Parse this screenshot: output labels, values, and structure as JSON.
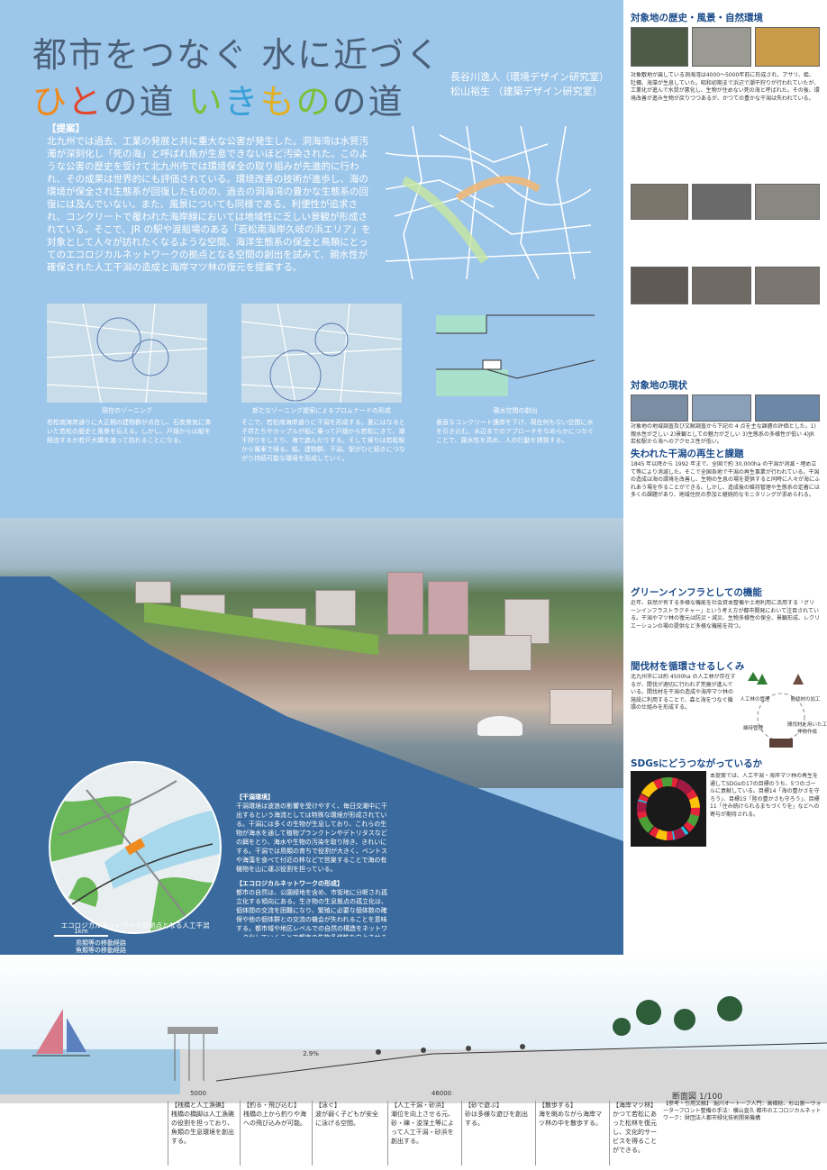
{
  "header": {
    "title": "都市をつなぐ 水に近づく",
    "subtitle_parts": [
      "ひ",
      "と",
      "の道 ",
      "い",
      "き",
      "も",
      "の",
      "の道"
    ],
    "authors": [
      "長谷川逸人（環境デザイン研究室）",
      "松山裕生 （建築デザイン研究室）"
    ]
  },
  "proposal": {
    "heading": "【提案】",
    "body": "北九州では過去、工業の発展と共に重大な公害が発生した。洞海湾は水質汚濁が深刻化し「死の海」と呼ばれ魚が生息できないほど汚染された。このような公害の歴史を受けて北九州市では環境保全の取り組みが先進的に行われ、その成果は世界的にも評価されている。環境改善の技術が進歩し、海の環境が保全され生態系が回復したものの、過去の洞海湾の豊かな生態系の回復には及んでいない。また、風景についても同様である。利便性が追求され、コンクリートで覆われた海岸線においては地域性に乏しい景観が形成されている。そこで、JR の駅や渡船場のある「若松南海岸久岐の浜エリア」を対象として人々が訪れたくなるような空間、海洋生態系の保全と鳥類にとってのエコロジカルネットワークの拠点となる空間の創出を試みて、親水性が確保された人工干潟の造成と海岸マツ林の復元を提案する。"
  },
  "diagrams": {
    "zoning": {
      "title": "現在のゾーニング",
      "text": "若松南海岸通りに大正期の建物群が点在し、石炭景気に沸いた若松の歴史と風景を伝える。しかし、戸畑からは船を経由するか若戸大橋を渡って訪れることになる。"
    },
    "promenade": {
      "title": "新たなゾーニング提案によるプロムナードの形成",
      "text": "そこで、若松南海岸通りに干潟を形成する。夏にはなると子供たちやカップルが船に乗って戸畑から若松にきて、潮干狩りをしたり、海で遊んだりする。そして帰りは若松駅から電車で帰る。船、建物群、干潟、駅がひと続きにつながり持続可能な環境を形成していく。"
    },
    "water": {
      "title": "親水空間の創出",
      "text": "垂直なコンクリート護岸を下げ、現在何もない空間に水を引き込む。水辺までのアプローチをなめらかにつなぐことで、親水性を高め、人の行動を誘発する。"
    }
  },
  "tidal": {
    "heading1": "【干潟環境】",
    "text1": "干潟環境は波浪の影響を受けやすく、毎日交潮中に干出するという海流としては特殊な環境が形成されている。干潟には多くの生物が生息しており、これらの生物が海水を通して植物プランクトンやデトリタスなどの餌をとり、海水や生物の汚染を取り除き、きれいにする。干潟では鳥類の育ちで役割が大きく、ベントスや海藻を食べて付近の林などで営巣することで海の有機物を山に運ぶ役割を担っている。",
    "heading2": "【エコロジカルネットワークの形成】",
    "text2": "都市の自然は、公園緑地を含め、市街地に分断され孤立化する傾向にある。生き物の生息拠点の孤立化は、個体間の交流を困難になり、繁殖に必要な個体数の確保や他の個体群との交流の機会が失われることを意味する。都市域や地区レベルでの自然の構造をネットワーク化していくことで都市の生物多様性を向上させることは、これからの都市づくりで重要な課題である。",
    "circle_caption": "エコロジカルネットワークの拠点となる人工干潟",
    "scale": "1km",
    "legend": [
      "鳥類等の移動経路",
      "魚類等の移動経路"
    ]
  },
  "right": {
    "h1": "対象地の歴史・風景・自然環境",
    "t1": "対象敷地が属している洞海湾は4000〜5000年前に形成され、アサリ、蛤、牡蠣、海藻が生息していた。昭和初期まで浜辺で潮干狩りが行われていたが、工業化が進んで水質が悪化し、生物が住めない死の海と呼ばれた。その後、環境改善が進み生物が戻りつつあるが、かつての豊かな干潟は失われている。",
    "h2": "対象地の現状",
    "t2": "対象地の地域調査及び文献調査から下記の 4 点を主な課題の評価とした。1)親水性が乏しい 2)景観としての魅力が乏しい 3)生態系の多様性が低い 4)JR 若松駅から海へのアクセス性が低い。",
    "h3": "失われた干潟の再生と課題",
    "t3": "1845 年以降から 1992 年まで、全国で約 30,000ha の干潟が消滅・埋め立て等により消滅した。そこで全国各地で干潟の再生事業が行われている。干潟の造成は海の環境を改善し、生物の生息の場を提供すると同時に人々が海にふれあう場を作ることができる。しかし、造成後の維持管理や生態系の定着には多くの課題があり、地域住民の参加と継続的なモニタリングが求められる。",
    "h4": "グリーンインフラとしての機能",
    "t4": "近年、自然が有する多様な機能を社会資本整備や土地利用に活用する「グリーンインフラストラクチャー」という考え方が都市開発において注目されている。干潟やマツ林の復元は防災・減災、生物多様性の保全、景観形成、レクリエーションの場の提供など多様な機能を持つ。",
    "h5": "間伐材を循環させるしくみ",
    "t5": "北九州市には約 4500ha の人工林が存在するが、間伐が適切に行われず荒廃が進んでいる。間伐材を干潟の造成や海岸マツ林の施設に利用することで、森と海をつなぐ循環の仕組みを形成する。",
    "cycle": [
      "人工林の管理",
      "間伐材の加工",
      "維持管理",
      "間伐材を用いた工作物作成"
    ],
    "h6": "SDGsにどうつながっているか",
    "t6": "本提案では、人工干潟・海岸マツ林の再生を通してSDGsの17の目標のうち、5つのゴールに貢献している。目標14「海の豊かさを守ろう」、目標15「陸の豊かさも守ろう」、目標11「住み続けられるまちづくりを」などへの寄与が期待される。"
  },
  "section": {
    "title": "断面図 1/100",
    "dims": [
      "5000",
      "46000"
    ],
    "level": "2.9%",
    "labels": [
      {
        "h": "【桟橋と人工漁礁】",
        "t": "桟橋の橋脚は人工漁礁の役割を担っており、魚類の生息環境を創出する。"
      },
      {
        "h": "【釣る・飛び込む】",
        "t": "桟橋の上から釣りや海への飛び込みが可能。"
      },
      {
        "h": "【泳ぐ】",
        "t": "波が弱く子どもが安全に泳げる空間。"
      },
      {
        "h": "【人工干潟・砂浜】",
        "t": "潮位を向上させる元、砂・礫・浚渫土等によって人工干潟・砂浜を創出する。"
      },
      {
        "h": "【砂で遊ぶ】",
        "t": "砂は多様な遊びを創出する。"
      },
      {
        "h": "【散歩する】",
        "t": "海を眺めながら海岸マツ林の中を散歩する。"
      },
      {
        "h": "【海岸マツ林】",
        "t": "かつて若松にあった松林を復元し、文化的サービスを得ることができる。"
      }
    ],
    "refs": "【参考・引用文献】 堀川オートーブ人門：高橋稔、杉山恵一ウォーターフロント整備の手法：横山直久 都市のエコロジカルネットワーク：財団法人都市緑化技術開発機構"
  },
  "colors": {
    "poster_bg": "#9cc6ea",
    "heading": "#1a4b8a",
    "sea": "#3b6b9e"
  }
}
